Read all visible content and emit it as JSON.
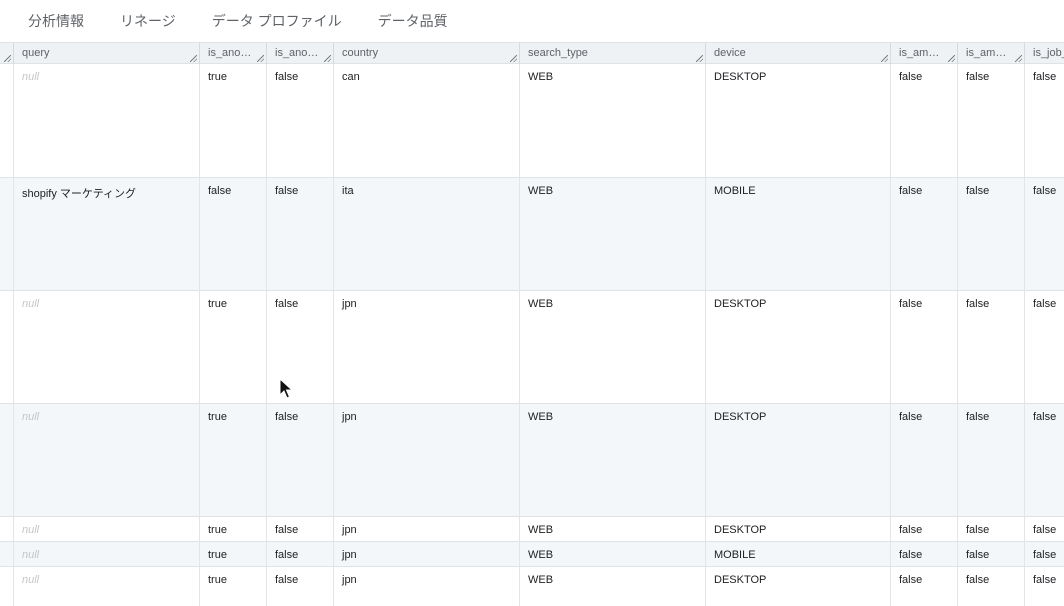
{
  "tabs": [
    "分析情報",
    "リネージ",
    "データ プロファイル",
    "データ品質"
  ],
  "columns": [
    "query",
    "is_anon...",
    "is_anon...",
    "country",
    "search_type",
    "device",
    "is_amp_...",
    "is_amp_...",
    "is_job_"
  ],
  "rows": [
    {
      "query": "null",
      "is_anon1": "true",
      "is_anon2": "false",
      "country": "can",
      "search_type": "WEB",
      "device": "DESKTOP",
      "is_amp1": "false",
      "is_amp2": "false",
      "is_job": "false"
    },
    {
      "query": "shopify マーケティング",
      "is_anon1": "false",
      "is_anon2": "false",
      "country": "ita",
      "search_type": "WEB",
      "device": "MOBILE",
      "is_amp1": "false",
      "is_amp2": "false",
      "is_job": "false"
    },
    {
      "query": "null",
      "is_anon1": "true",
      "is_anon2": "false",
      "country": "jpn",
      "search_type": "WEB",
      "device": "DESKTOP",
      "is_amp1": "false",
      "is_amp2": "false",
      "is_job": "false"
    },
    {
      "query": "null",
      "is_anon1": "true",
      "is_anon2": "false",
      "country": "jpn",
      "search_type": "WEB",
      "device": "DESKTOP",
      "is_amp1": "false",
      "is_amp2": "false",
      "is_job": "false"
    },
    {
      "query": "null",
      "is_anon1": "true",
      "is_anon2": "false",
      "country": "jpn",
      "search_type": "WEB",
      "device": "DESKTOP",
      "is_amp1": "false",
      "is_amp2": "false",
      "is_job": "false"
    },
    {
      "query": "null",
      "is_anon1": "true",
      "is_anon2": "false",
      "country": "jpn",
      "search_type": "WEB",
      "device": "MOBILE",
      "is_amp1": "false",
      "is_amp2": "false",
      "is_job": "false"
    },
    {
      "query": "null",
      "is_anon1": "true",
      "is_anon2": "false",
      "country": "jpn",
      "search_type": "WEB",
      "device": "DESKTOP",
      "is_amp1": "false",
      "is_amp2": "false",
      "is_job": "false"
    }
  ]
}
